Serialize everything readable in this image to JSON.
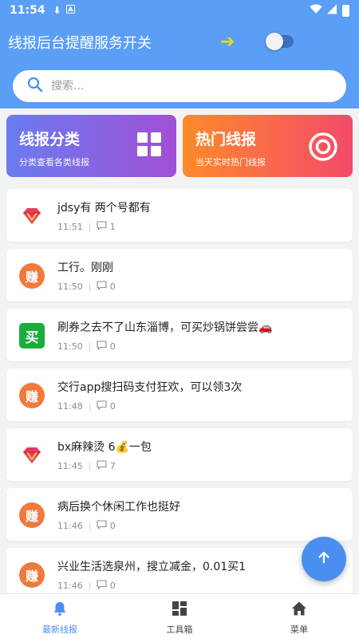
{
  "status_bar": {
    "time": "11:54"
  },
  "header": {
    "toggle_label": "线报后台提醒服务开关",
    "arrow": "➔",
    "search_placeholder": "搜索..."
  },
  "categories": [
    {
      "title": "线报分类",
      "subtitle": "分类查看各类线报"
    },
    {
      "title": "热门线报",
      "subtitle": "当天实时热门线报"
    }
  ],
  "posts": [
    {
      "avatar": "diamond-icon",
      "avatar_text": "",
      "text": "jdsy有 两个号都有",
      "time": "11:51",
      "comments": "1"
    },
    {
      "avatar": "zhuan-avatar",
      "avatar_text": "赚",
      "text": "工行。刚刚",
      "time": "11:50",
      "comments": "0"
    },
    {
      "avatar": "mai-avatar",
      "avatar_text": "买",
      "text": "刷券之去不了山东淄博，可买炒锅饼尝尝🚗",
      "time": "11:50",
      "comments": "0"
    },
    {
      "avatar": "zhuan-avatar",
      "avatar_text": "赚",
      "text": "交行app搜扫码支付狂欢，可以领3次",
      "time": "11:48",
      "comments": "0"
    },
    {
      "avatar": "diamond-icon",
      "avatar_text": "",
      "text": "bx麻辣烫 6💰一包",
      "time": "11:45",
      "comments": "7"
    },
    {
      "avatar": "zhuan-avatar",
      "avatar_text": "赚",
      "text": "病后换个休闲工作也挺好",
      "time": "11:46",
      "comments": "0"
    },
    {
      "avatar": "zhuan-avatar",
      "avatar_text": "赚",
      "text": "兴业生活选泉州，搜立减金，0.01买1",
      "time": "11:46",
      "comments": "0"
    }
  ],
  "tabs": [
    {
      "label": "最新线报",
      "icon": "bell-icon",
      "active": true
    },
    {
      "label": "工具箱",
      "icon": "grid-icon",
      "active": false
    },
    {
      "label": "菜单",
      "icon": "home-icon",
      "active": false
    }
  ],
  "colors": {
    "header": "#5b9ef6",
    "accent": "#4a8ff0",
    "arrow": "#f5d90a"
  }
}
